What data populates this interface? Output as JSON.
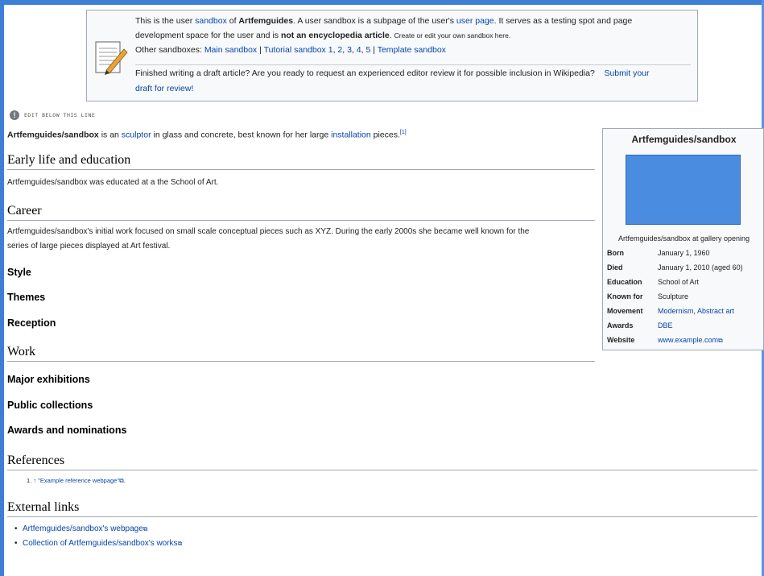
{
  "notice": {
    "line1_a": "This is the user ",
    "line1_link_sandbox": "sandbox",
    "line1_b": " of ",
    "line1_user": "Artfemguides",
    "line1_c": ". A user sandbox is a subpage of the user's ",
    "line1_link_userpage": "user page",
    "line1_d": ". It serves as a testing spot and page",
    "line2_a": "development space for the user and is ",
    "line2_bold": "not an encyclopedia article",
    "line2_b": ". ",
    "line2_small": "Create or edit your own sandbox here.",
    "line3_a": "Other sandboxes: ",
    "line3_main": "Main sandbox",
    "line3_sep1": " | ",
    "line3_tutorial": "Tutorial sandbox",
    "line3_n1": "1",
    "line3_n2": "2",
    "line3_n3": "3",
    "line3_n4": "4",
    "line3_n5": "5",
    "line3_sep2": " | ",
    "line3_template": "Template sandbox",
    "draft_text": "Finished writing a draft article? Are you ready to request an experienced editor review it for possible inclusion in Wikipedia?",
    "draft_link_a": "Submit your",
    "draft_link_b": "draft for review!"
  },
  "edit_below": "EDIT BELOW THIS LINE",
  "lead": {
    "subject": "Artfemguides/sandbox",
    "a": " is an ",
    "sculptor": "sculptor",
    "b": " in glass and concrete, best known for her large ",
    "installation": "installation",
    "c": " pieces.",
    "ref": "[1]"
  },
  "sections": {
    "early_life": "Early life and education",
    "early_life_text": "Artfemguides/sandbox was educated at a the School of Art.",
    "career": "Career",
    "career_text_1": "Artfemguides/sandbox's initial work focused on small scale conceptual pieces such as XYZ. During the early 2000s she became well known for the",
    "career_text_2": "series of large pieces displayed at Art festival.",
    "style": "Style",
    "themes": "Themes",
    "reception": "Reception",
    "work": "Work",
    "major_exhibitions": "Major exhibitions",
    "public_collections": "Public collections",
    "awards_nominations": "Awards and nominations",
    "references": "References",
    "external_links": "External links"
  },
  "references": [
    {
      "num": "1.",
      "arrow": "↑",
      "text": "\"Example reference webpage\"",
      "tail": "."
    }
  ],
  "external_links": [
    "Artfemguides/sandbox's webpage",
    "Collection of Artfemguides/sandbox's works"
  ],
  "infobox": {
    "title": "Artfemguides/sandbox",
    "caption": "Artfemguides/sandbox at gallery opening",
    "rows": [
      {
        "label": "Born",
        "value": "January 1, 1960"
      },
      {
        "label": "Died",
        "value": "January 1, 2010 (aged 60)"
      },
      {
        "label": "Education",
        "value": "School of Art"
      },
      {
        "label": "Known for",
        "value": "Sculpture"
      },
      {
        "label": "Movement",
        "value": "Modernism",
        "value2": "Abstract art"
      },
      {
        "label": "Awards",
        "value": "DBE"
      },
      {
        "label": "Website",
        "value": "www.example.com"
      }
    ]
  },
  "colors": {
    "link": "#0645ad",
    "frame": "#3d7fd6",
    "image_placeholder": "#4a8de0"
  }
}
